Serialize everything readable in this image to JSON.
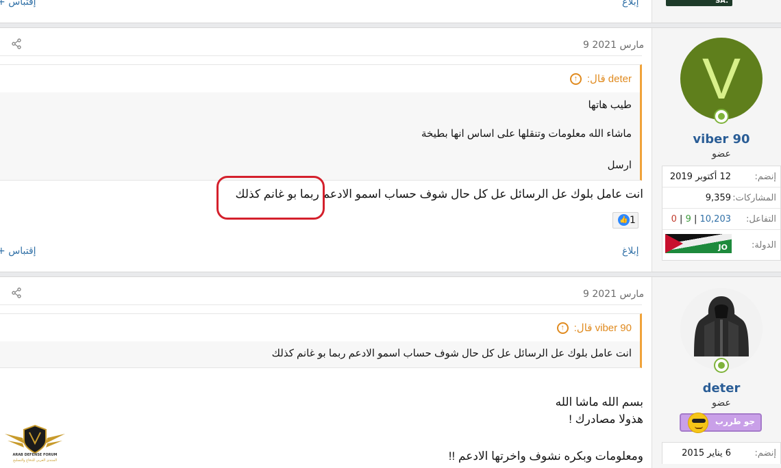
{
  "top": {
    "report": "إبلاغ",
    "quote": "+ إقتباس"
  },
  "post1": {
    "date": "9 مارس 2021",
    "quote_author": "deter قال:",
    "quote_lines": [
      "طيب هاتها",
      "ماشاء الله معلومات وتنقلها على اساس انها بطيخة",
      "ارسل"
    ],
    "message": "انت عامل بلوك عل الرسائل عل كل حال شوف حساب اسمو الادعم ربما بو غانم كذلك",
    "reaction_count": "1",
    "report": "إبلاغ",
    "quote": "+ إقتباس"
  },
  "user1": {
    "avatar_letter": "V",
    "name": "viber 90",
    "title": "عضو",
    "rows": [
      {
        "label": "إنضم:",
        "value": "12 أكتوبر 2019"
      },
      {
        "label": "المشاركات:",
        "value": "9,359"
      },
      {
        "label": "التفاعل:",
        "value": "10,203 | 9 | 0"
      },
      {
        "label": "الدولة:",
        "value": ""
      }
    ],
    "reactions": {
      "positive": "10,203",
      "neutral": "9",
      "negative": "0"
    },
    "flag_text": "JO"
  },
  "post2": {
    "date": "9 مارس 2021",
    "quote_author": "viber 90 قال:",
    "quote_line": "انت عامل بلوك عل الرسائل عل كل حال شوف حساب اسمو الادعم ربما بو غانم كذلك",
    "message_lines": [
      "بسم الله ماشا الله",
      "هذولا مصادرك !",
      "",
      "ومعلومات وبكره نشوف واخرتها الادعم !!"
    ]
  },
  "user2": {
    "name": "deter",
    "title": "عضو",
    "badge": "جو طررب",
    "rows": [
      {
        "label": "إنضم:",
        "value": "6 يناير 2015"
      }
    ]
  },
  "logo": {
    "line1": "ARAB DEFENSE FORUM",
    "line2": "المنتدى العربي للدفاع والتسليح"
  },
  "colors": {
    "accent": "#2f6fa6",
    "quote_border": "#f0a33a",
    "highlight": "#d4202c"
  }
}
